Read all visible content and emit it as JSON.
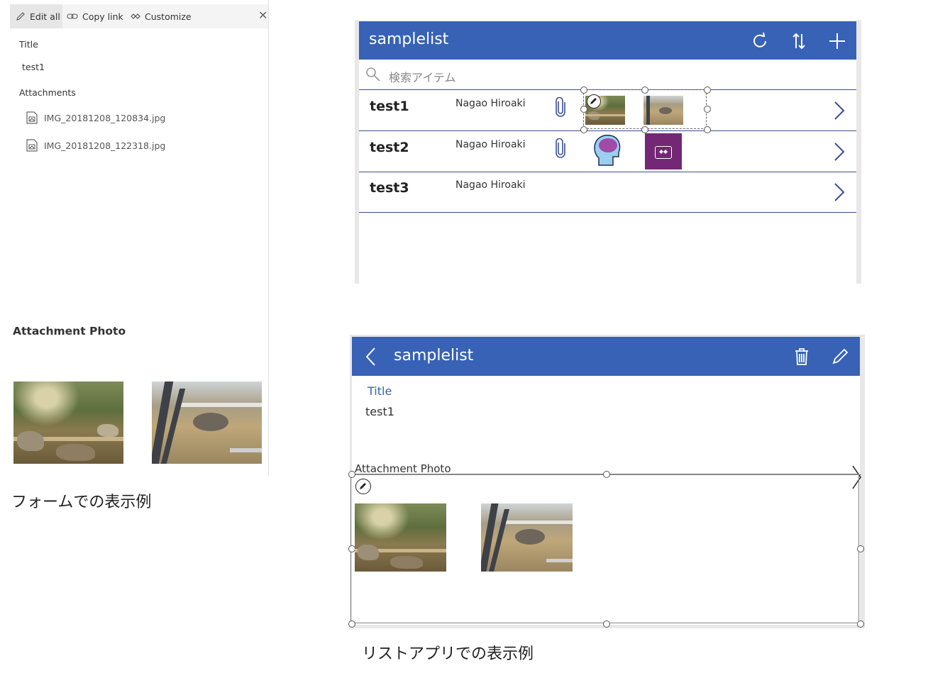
{
  "sp_form": {
    "toolbar": {
      "edit_all": "Edit all",
      "copy_link": "Copy link",
      "customize": "Customize",
      "close": "✕"
    },
    "title_label": "Title",
    "title_value": "test1",
    "attachments_label": "Attachments",
    "attachments": [
      "IMG_20181208_120834.jpg",
      "IMG_20181208_122318.jpg"
    ],
    "photo_section_title": "Attachment Photo"
  },
  "caption_form": "フォームでの表示例",
  "pa_list": {
    "title": "samplelist",
    "search_placeholder": "検索アイテム",
    "header_icons": [
      "refresh-icon",
      "sort-icon",
      "add-icon"
    ],
    "rows": [
      {
        "title": "test1",
        "subtitle": "Nagao Hiroaki",
        "has_attachment": true
      },
      {
        "title": "test2",
        "subtitle": "Nagao Hiroaki",
        "has_attachment": true
      },
      {
        "title": "test3",
        "subtitle": "Nagao Hiroaki",
        "has_attachment": false
      }
    ],
    "accent_color": "#3762b6"
  },
  "pa_detail": {
    "title": "samplelist",
    "field_label": "Title",
    "field_value": "test1",
    "photo_label": "Attachment Photo",
    "header_icons": [
      "back-icon",
      "trash-icon",
      "edit-icon"
    ]
  },
  "caption_app": "リストアプリでの表示例"
}
